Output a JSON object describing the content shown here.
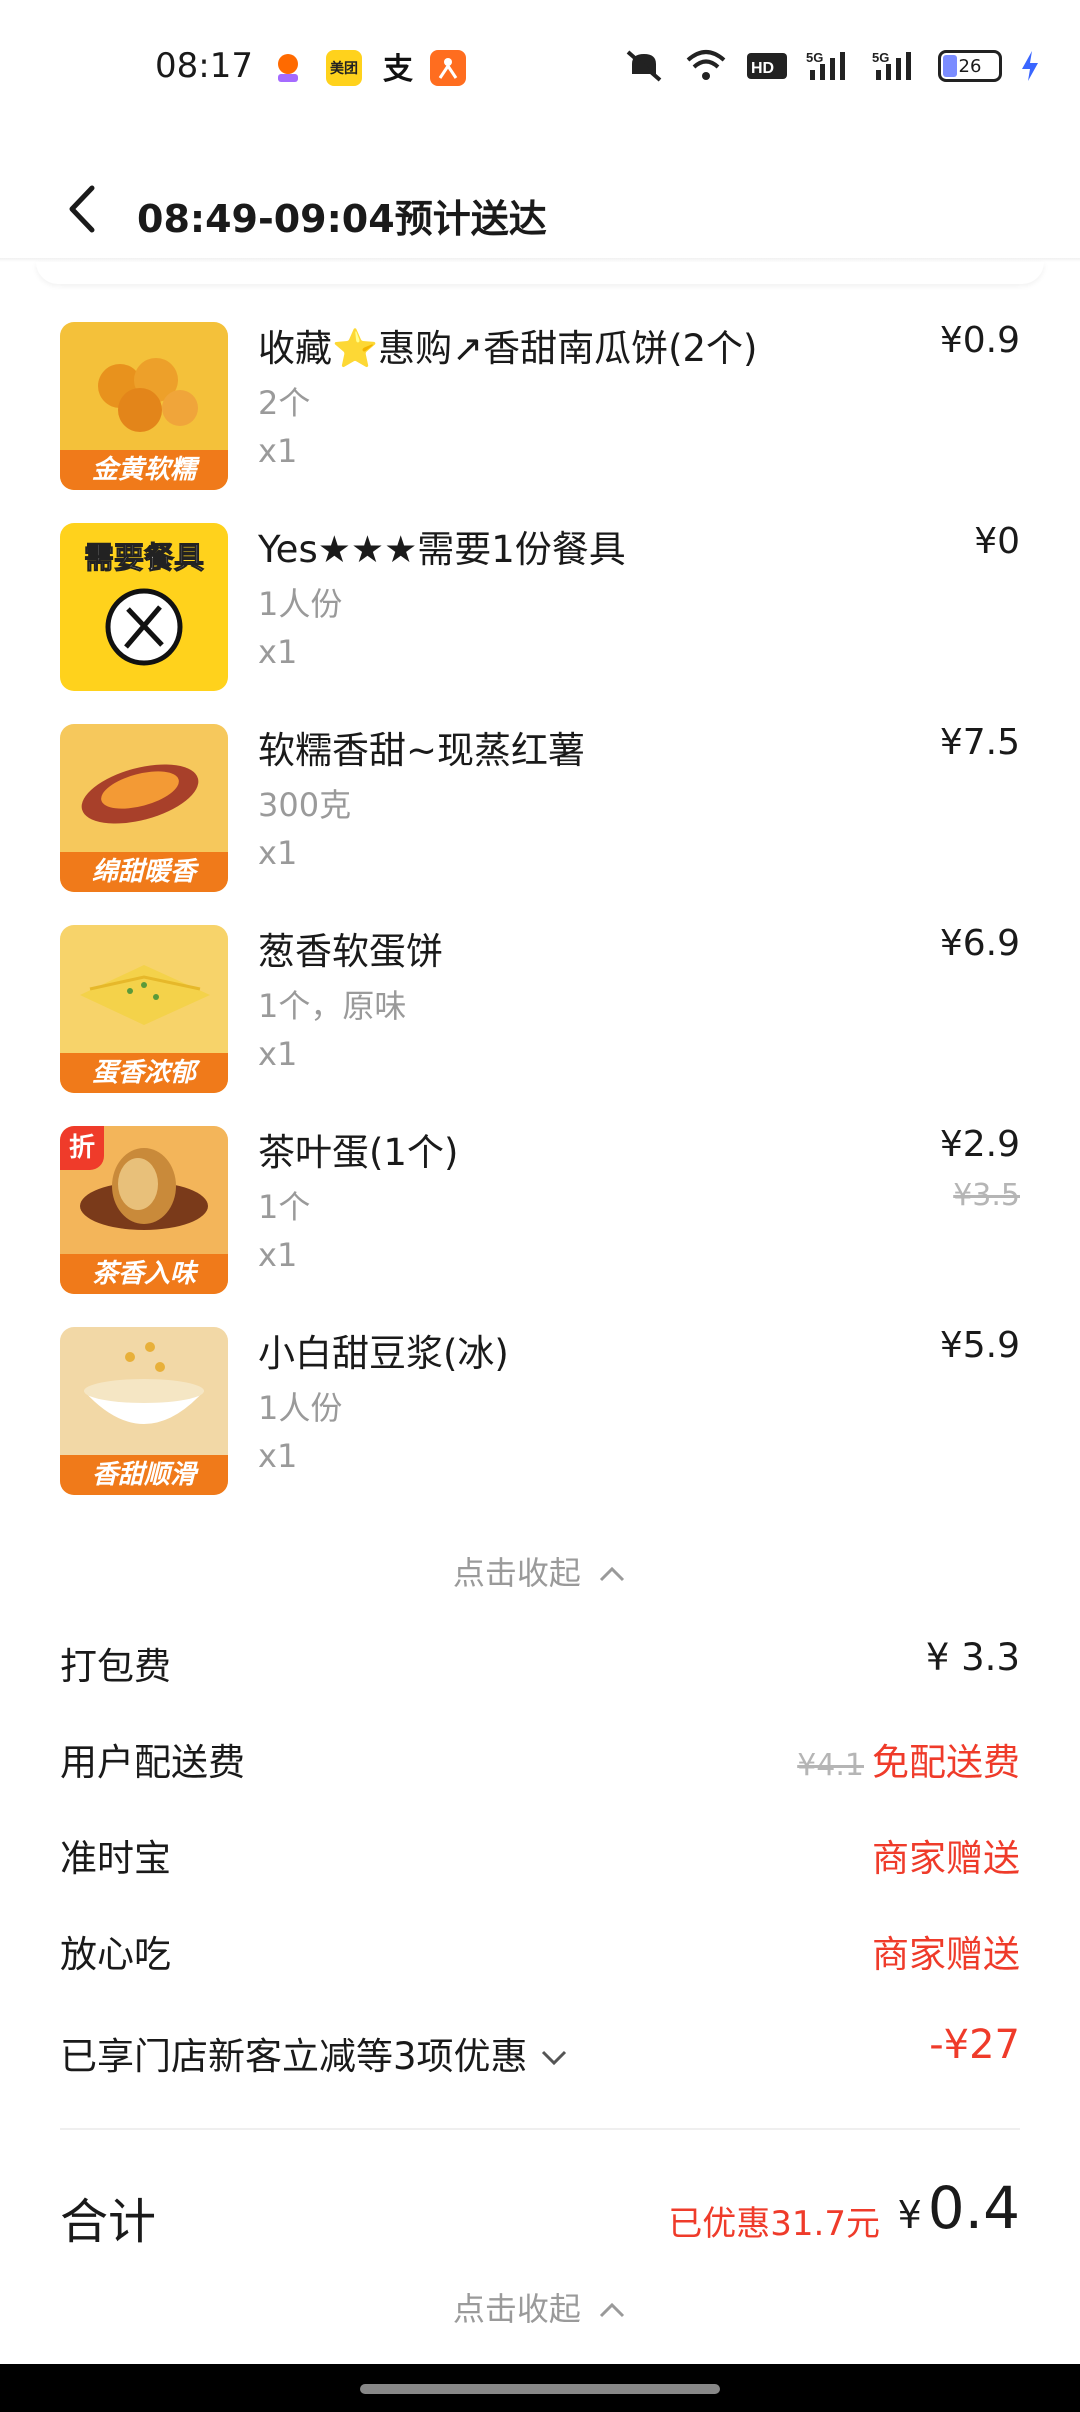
{
  "status_bar": {
    "time": "08:17",
    "apps": [
      "meituan-waimai",
      "美团",
      "alipay",
      "dianping"
    ],
    "battery": "26"
  },
  "header": {
    "title": "08:49-09:04预计送达"
  },
  "items": [
    {
      "name": "收藏⭐惠购↗香甜南瓜饼(2个)",
      "spec": "2个",
      "qty": "x1",
      "price": "¥0.9",
      "badge": "金黄软糯",
      "thumb_color": "#f4c13a"
    },
    {
      "name": "Yes★★★需要1份餐具",
      "spec": "1人份",
      "qty": "x1",
      "price": "¥0",
      "badge": "需要餐具",
      "thumb_color": "#ffd21c"
    },
    {
      "name": "软糯香甜~现蒸红薯",
      "spec": "300克",
      "qty": "x1",
      "price": "¥7.5",
      "badge": "绵甜暖香",
      "thumb_color": "#f6c85c"
    },
    {
      "name": "葱香软蛋饼",
      "spec": "1个，原味",
      "qty": "x1",
      "price": "¥6.9",
      "badge": "蛋香浓郁",
      "thumb_color": "#f7d36a"
    },
    {
      "name": "茶叶蛋(1个)",
      "spec": "1个",
      "qty": "x1",
      "price": "¥2.9",
      "price_old": "¥3.5",
      "badge": "茶香入味",
      "tag": "折",
      "thumb_color": "#f3b55a"
    },
    {
      "name": "小白甜豆浆(冰)",
      "spec": "1人份",
      "qty": "x1",
      "price": "¥5.9",
      "badge": "香甜顺滑",
      "thumb_color": "#f2d8a6"
    }
  ],
  "collapse_label": "点击收起",
  "fees": {
    "packing": {
      "label": "打包费",
      "value": "¥ 3.3"
    },
    "delivery": {
      "label": "用户配送费",
      "old": "¥4.1",
      "value": "免配送费"
    },
    "ontime": {
      "label": "准时宝",
      "value": "商家赠送"
    },
    "worry_free": {
      "label": "放心吃",
      "value": "商家赠送"
    },
    "discount": {
      "label": "已享门店新客立减等3项优惠",
      "value": "-¥27"
    }
  },
  "total": {
    "label": "合计",
    "saved": "已优惠31.7元",
    "currency": "¥",
    "value": "0.4"
  },
  "colors": {
    "accent_red": "#ef3b2a",
    "band_orange": "#f07a1a",
    "gray_text": "#9a9a9a"
  }
}
